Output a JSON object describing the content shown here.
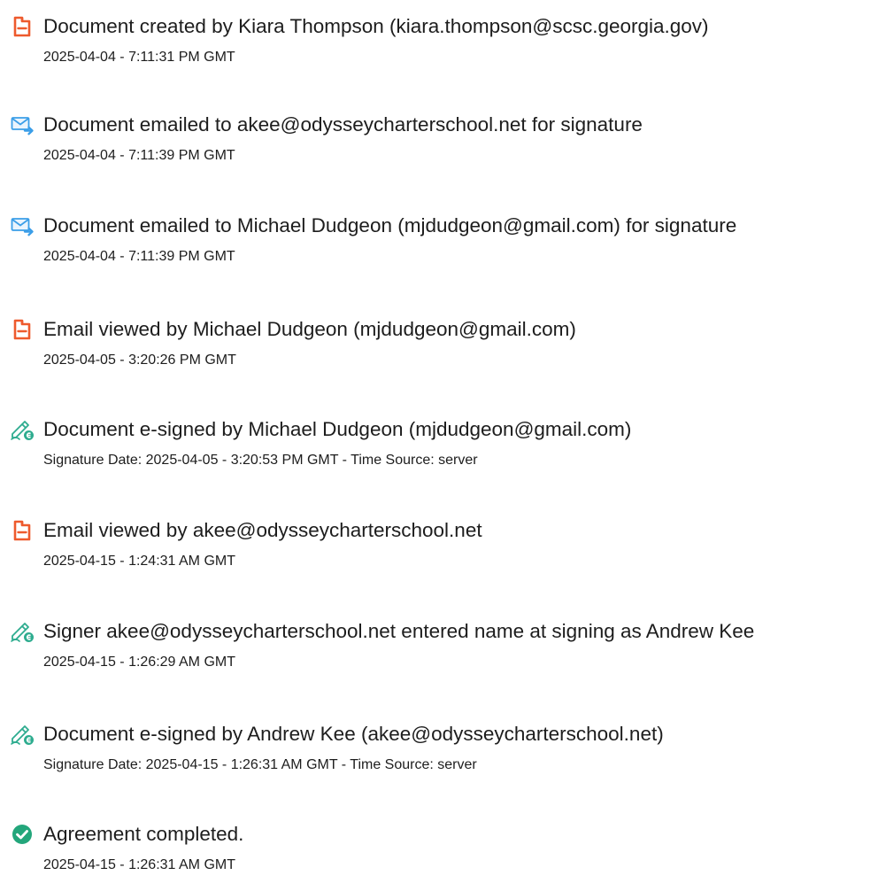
{
  "audit_events": [
    {
      "icon": "document-created-icon",
      "title": "Document created by Kiara Thompson (kiara.thompson@scsc.georgia.gov)",
      "detail": "2025-04-04 - 7:11:31 PM GMT"
    },
    {
      "icon": "email-sent-icon",
      "title": "Document emailed to akee@odysseycharterschool.net for signature",
      "detail": "2025-04-04 - 7:11:39 PM GMT"
    },
    {
      "icon": "email-sent-icon",
      "title": "Document emailed to Michael Dudgeon (mjdudgeon@gmail.com) for signature",
      "detail": "2025-04-04 - 7:11:39 PM GMT"
    },
    {
      "icon": "document-viewed-icon",
      "title": "Email viewed by Michael Dudgeon (mjdudgeon@gmail.com)",
      "detail": "2025-04-05 - 3:20:26 PM GMT"
    },
    {
      "icon": "e-sign-icon",
      "title": "Document e-signed by Michael Dudgeon (mjdudgeon@gmail.com)",
      "detail": "Signature Date: 2025-04-05 - 3:20:53 PM GMT - Time Source: server"
    },
    {
      "icon": "document-viewed-icon",
      "title": "Email viewed by akee@odysseycharterschool.net",
      "detail": "2025-04-15 - 1:24:31 AM GMT"
    },
    {
      "icon": "e-sign-icon",
      "title": "Signer akee@odysseycharterschool.net entered name at signing as Andrew Kee",
      "detail": "2025-04-15 - 1:26:29 AM GMT"
    },
    {
      "icon": "e-sign-icon",
      "title": "Document e-signed by Andrew Kee (akee@odysseycharterschool.net)",
      "detail": "Signature Date: 2025-04-15 - 1:26:31 AM GMT - Time Source: server"
    },
    {
      "icon": "completed-check-icon",
      "title": "Agreement completed.",
      "detail": "2025-04-15 - 1:26:31 AM GMT"
    }
  ],
  "colors": {
    "acrobat_orange": "#ee5a2d",
    "email_blue": "#3b9ee8",
    "sign_green": "#2eac8f",
    "check_green": "#23a67b"
  }
}
